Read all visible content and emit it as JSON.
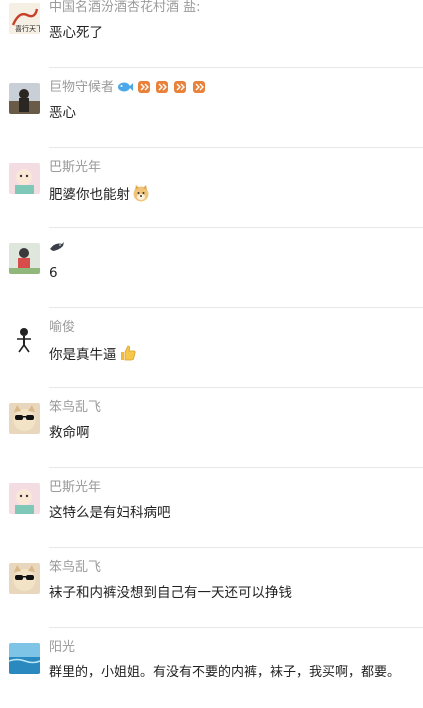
{
  "comments": [
    {
      "name": "中国名酒汾酒杏花村酒 盐:",
      "text": "恶心死了",
      "avatar_icon": "calligraphy-avatar-icon",
      "avatar_text": "喜行天下"
    },
    {
      "name": "巨物守候者",
      "text": "恶心",
      "avatar_icon": "person-silhouette-avatar-icon",
      "name_badges": [
        "fish-badge-icon",
        "rank-badge-icon",
        "rank-badge-icon",
        "rank-badge-icon",
        "rank-badge-icon"
      ]
    },
    {
      "name": "巴斯光年",
      "text": "肥婆你也能射",
      "avatar_icon": "cartoon-avatar-icon",
      "trailing_emoji": "doge-emoji-icon"
    },
    {
      "name": "",
      "text": "6",
      "avatar_icon": "person-avatar-icon",
      "name_badges": [
        "dolphin-badge-icon"
      ]
    },
    {
      "name": "喻俊",
      "text": "你是真牛逼",
      "avatar_icon": "stick-figure-avatar-icon",
      "trailing_emoji": "thumbs-up-emoji-icon"
    },
    {
      "name": "笨鸟乱飞",
      "text": "救命啊",
      "avatar_icon": "cat-sunglasses-avatar-icon"
    },
    {
      "name": "巴斯光年",
      "text": "这特么是有妇科病吧",
      "avatar_icon": "cartoon-avatar-icon"
    },
    {
      "name": "笨鸟乱飞",
      "text": "袜子和内裤没想到自己有一天还可以挣钱",
      "avatar_icon": "cat-sunglasses-avatar-icon"
    },
    {
      "name": "阳光",
      "text": "群里的，小姐姐。有没有不要的内裤，袜子，我买啊，都要。",
      "avatar_icon": "ocean-avatar-icon"
    }
  ],
  "colors": {
    "name": "#9a9a9a",
    "text": "#222222",
    "divider": "#e8e8e8",
    "badge_orange": "#e8823a",
    "fish_blue": "#4aa8e8"
  }
}
